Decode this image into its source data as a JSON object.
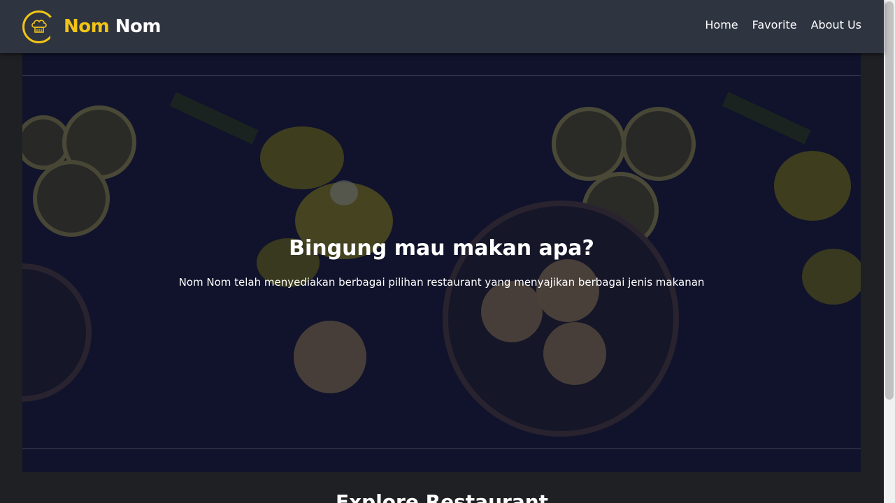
{
  "header": {
    "brand": {
      "part1": "Nom",
      "part2": "Nom",
      "logo_icon": "chef-hat-icon"
    },
    "nav": [
      {
        "label": "Home"
      },
      {
        "label": "Favorite"
      },
      {
        "label": "About Us"
      }
    ]
  },
  "hero": {
    "title": "Bingung mau makan apa?",
    "subtitle": "Nom Nom telah menyediakan berbagai pilihan restaurant yang menyajikan berbagai jenis makanan"
  },
  "section": {
    "title": "Explore Restaurant"
  },
  "colors": {
    "accent": "#f2c417",
    "navbar": "#2e3440",
    "background": "#1f2023",
    "hero": "#131629"
  }
}
